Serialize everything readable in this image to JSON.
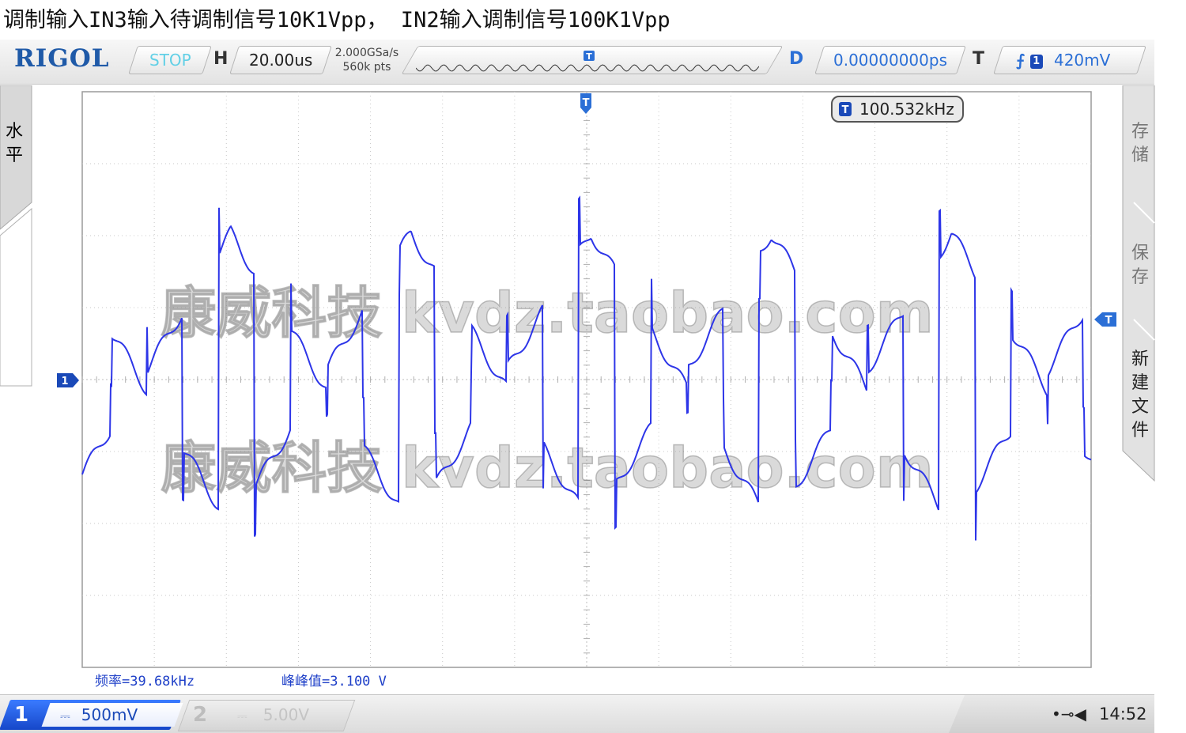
{
  "caption": "调制输入IN3输入待调制信号10K1Vpp， IN2输入调制信号100K1Vpp",
  "header": {
    "brand": "RIGOL",
    "run_state": "STOP",
    "h_label": "H",
    "timebase": "20.00us",
    "sample_rate": "2.000GSa/s",
    "memory_depth": "560k pts",
    "d_label": "D",
    "delay": "0.00000000ps",
    "t_label": "T",
    "trigger_source": "1",
    "trigger_level": "420mV",
    "trigger_edge_icon": "rising-edge-icon"
  },
  "left_menu": {
    "label_line1": "水",
    "label_line2": "平"
  },
  "right_menu": {
    "item1_line1": "存",
    "item1_line2": "储",
    "item2_line1": "保",
    "item2_line2": "存",
    "item3_line1": "新",
    "item3_line2": "建",
    "item3_line3": "文",
    "item3_line4": "件"
  },
  "screen": {
    "trigger_freq_badge": "T",
    "trigger_freq": "100.532kHz",
    "watermark": "康威科技 kvdz.taobao.com",
    "ch1_marker": "1",
    "trigger_marker": "T",
    "trace_color": "#2d35e8",
    "measurement_freq": "频率=39.68kHz",
    "measurement_vpp": "峰峰值=3.100 V"
  },
  "footer": {
    "ch1_number": "1",
    "ch1_coupling": "⎓",
    "ch1_scale": "500mV",
    "ch2_number": "2",
    "ch2_coupling": "⎓",
    "ch2_scale": "5.00V",
    "usb_icon": "usb-icon",
    "speaker_icon": "speaker-icon",
    "clock": "14:52"
  }
}
